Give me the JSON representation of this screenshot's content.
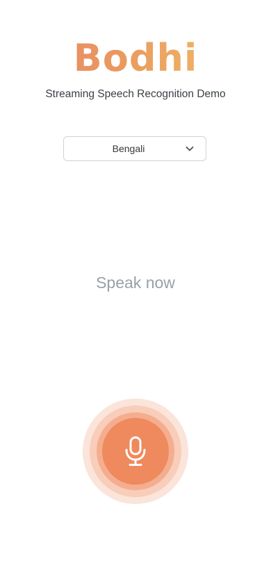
{
  "brand": {
    "logo_text": "Bodhi",
    "subtitle": "Streaming Speech Recognition Demo"
  },
  "language_select": {
    "selected": "Bengali"
  },
  "prompt": {
    "text": "Speak now"
  },
  "mic": {
    "icon": "microphone-icon"
  },
  "colors": {
    "logo_gradient_start": "#e8856a",
    "logo_gradient_end": "#f3c46b",
    "mic_button": "#ee8a5d",
    "mic_ring_outer": "#fbe4da",
    "mic_ring_middle": "#f8cdb9",
    "mic_ring_inner": "#f4ad8f",
    "prompt_text": "#9aa0a6"
  }
}
